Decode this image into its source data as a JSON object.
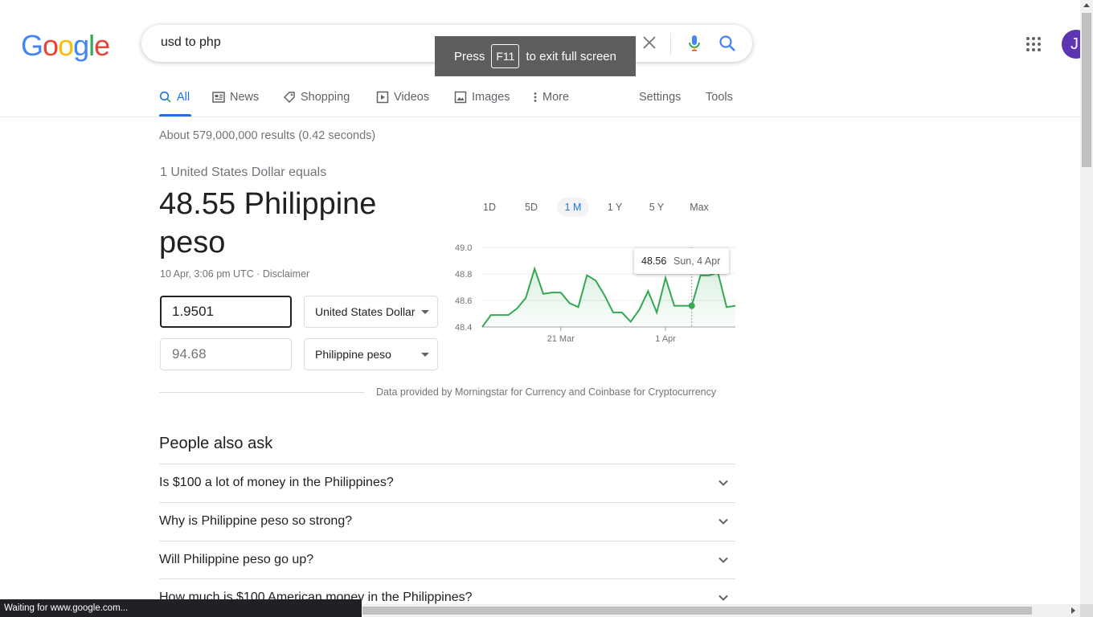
{
  "logo": {
    "letters": [
      "G",
      "o",
      "o",
      "g",
      "l",
      "e"
    ],
    "colors": [
      "#4285F4",
      "#EA4335",
      "#FBBC05",
      "#4285F4",
      "#34A853",
      "#EA4335"
    ]
  },
  "search": {
    "query": "usd to php"
  },
  "fullscreen_banner": {
    "press": "Press",
    "key": "F11",
    "message": "to exit full screen"
  },
  "account": {
    "initial": "J",
    "color": "#5e35b1"
  },
  "tabs": [
    {
      "label": "All",
      "icon": "search-icon",
      "active": true
    },
    {
      "label": "News",
      "icon": "news-icon"
    },
    {
      "label": "Shopping",
      "icon": "tag-icon"
    },
    {
      "label": "Videos",
      "icon": "play-icon"
    },
    {
      "label": "Images",
      "icon": "image-icon"
    },
    {
      "label": "More",
      "icon": "more-vert-icon"
    },
    {
      "label": "Settings"
    },
    {
      "label": "Tools"
    }
  ],
  "stats": "About 579,000,000 results (0.42 seconds)",
  "converter": {
    "equals": "1 United States Dollar equals",
    "result": "48.55 Philippine peso",
    "date": "10 Apr, 3:06 pm UTC",
    "disclaimer": "Disclaimer",
    "from_amount": "1.9501",
    "from_currency": "United States Dollar",
    "to_amount": "94.68",
    "to_currency": "Philippine peso",
    "ranges": [
      "1D",
      "5D",
      "1 M",
      "1 Y",
      "5 Y",
      "Max"
    ],
    "active_range": "1 M",
    "tooltip_value": "48.56",
    "tooltip_date": "Sun, 4 Apr",
    "source": "Data provided by Morningstar for Currency and Coinbase for Cryptocurrency"
  },
  "chart_data": {
    "type": "area",
    "ylim": [
      48.4,
      49.0
    ],
    "yticks": [
      "49.0",
      "48.8",
      "48.6",
      "48.4"
    ],
    "xticks": [
      "21 Mar",
      "1 Apr"
    ],
    "color": "#34a853",
    "series": [
      {
        "values": [
          48.4,
          48.49,
          48.49,
          48.49,
          48.54,
          48.62,
          48.84,
          48.65,
          48.66,
          48.66,
          48.58,
          48.55,
          48.79,
          48.75,
          48.64,
          48.51,
          48.51,
          48.44,
          48.53,
          48.67,
          48.51,
          48.77,
          48.56,
          48.56,
          48.56,
          48.79,
          48.79,
          48.81,
          48.55,
          48.56
        ]
      }
    ],
    "highlight_index": 24
  },
  "people_also_ask": {
    "title": "People also ask",
    "questions": [
      "Is $100 a lot of money in the Philippines?",
      "Why is Philippine peso so strong?",
      "Will Philippine peso go up?",
      "How much is $100 American money in the Philippines?"
    ]
  },
  "status_bar": "Waiting for www.google.com..."
}
